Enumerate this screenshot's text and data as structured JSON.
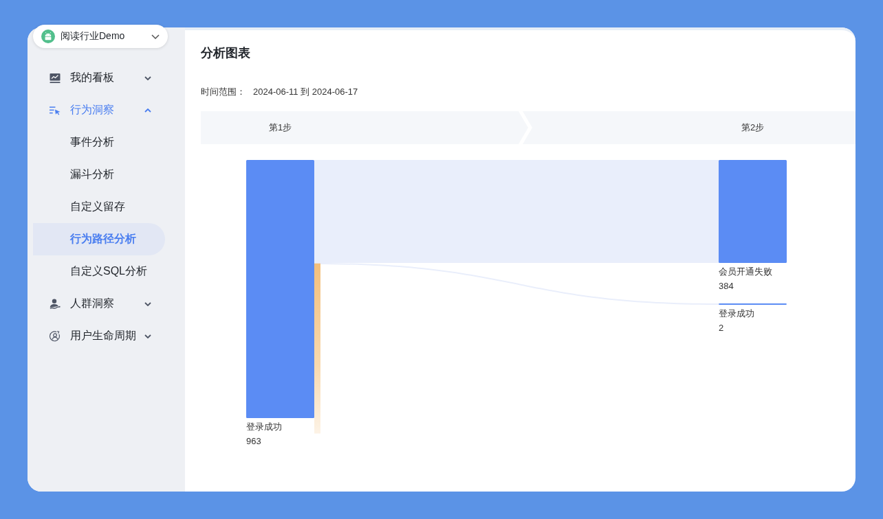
{
  "app_selector": {
    "label": "阅读行业Demo"
  },
  "sidebar": {
    "items": [
      {
        "label": "我的看板",
        "expanded": false
      },
      {
        "label": "行为洞察",
        "expanded": true,
        "children": [
          {
            "label": "事件分析",
            "selected": false
          },
          {
            "label": "漏斗分析",
            "selected": false
          },
          {
            "label": "自定义留存",
            "selected": false
          },
          {
            "label": "行为路径分析",
            "selected": true
          },
          {
            "label": "自定义SQL分析",
            "selected": false
          }
        ]
      },
      {
        "label": "人群洞察",
        "expanded": false
      },
      {
        "label": "用户生命周期",
        "expanded": false
      }
    ]
  },
  "main": {
    "title": "分析图表",
    "time_range": {
      "label": "时间范围：",
      "value": "2024-06-11 到 2024-06-17"
    },
    "path_chart": {
      "steps": [
        {
          "label": "第1步",
          "nodes": [
            {
              "name": "登录成功",
              "value": "963"
            }
          ]
        },
        {
          "label": "第2步",
          "nodes": [
            {
              "name": "会员开通失败",
              "value": "384"
            },
            {
              "name": "登录成功",
              "value": "2"
            }
          ]
        }
      ]
    }
  }
}
